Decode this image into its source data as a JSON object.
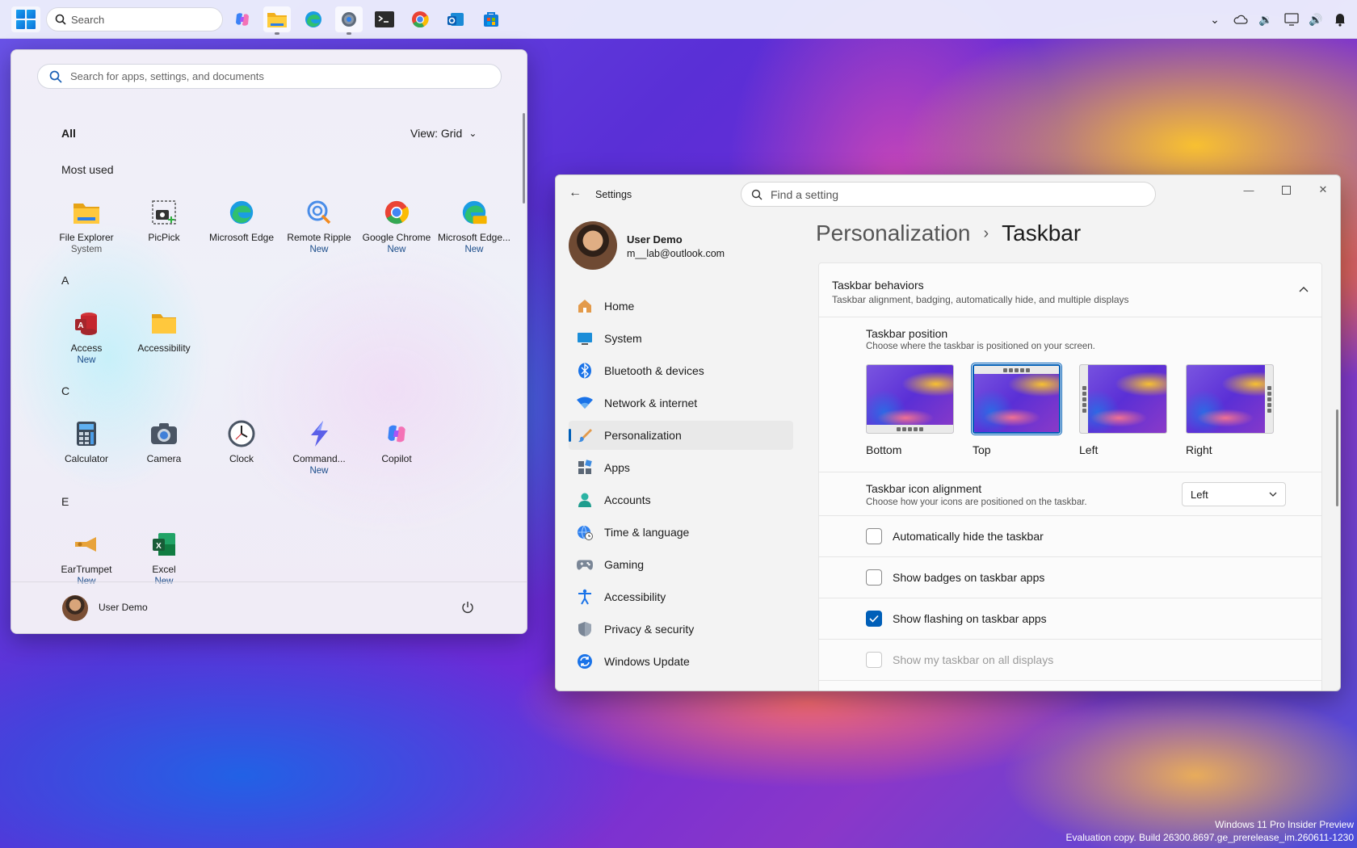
{
  "taskbar": {
    "search_label": "Search",
    "apps": [
      {
        "name": "copilot-icon"
      },
      {
        "name": "file-explorer-icon"
      },
      {
        "name": "edge-icon"
      },
      {
        "name": "settings-icon"
      },
      {
        "name": "terminal-icon"
      },
      {
        "name": "chrome-icon"
      },
      {
        "name": "outlook-icon"
      },
      {
        "name": "store-icon"
      }
    ],
    "tray": [
      "chevron-up-icon",
      "onedrive-cloud-icon",
      "volume-icon",
      "display-icon",
      "speaker-icon",
      "notification-bell-icon"
    ]
  },
  "start_menu": {
    "search_placeholder": "Search for apps, settings, and documents",
    "all_label": "All",
    "view_label": "View: Grid",
    "most_used_label": "Most used",
    "most_used": [
      {
        "label": "File Explorer",
        "sub": "System"
      },
      {
        "label": "PicPick",
        "sub": ""
      },
      {
        "label": "Microsoft Edge",
        "sub": ""
      },
      {
        "label": "Remote Ripple",
        "sub": "New"
      },
      {
        "label": "Google Chrome",
        "sub": "New"
      },
      {
        "label": "Microsoft Edge...",
        "sub": "New"
      }
    ],
    "section_a": "A",
    "apps_a": [
      {
        "label": "Access",
        "sub": "New"
      },
      {
        "label": "Accessibility",
        "sub": ""
      }
    ],
    "section_c": "C",
    "apps_c": [
      {
        "label": "Calculator",
        "sub": ""
      },
      {
        "label": "Camera",
        "sub": ""
      },
      {
        "label": "Clock",
        "sub": ""
      },
      {
        "label": "Command...",
        "sub": "New"
      },
      {
        "label": "Copilot",
        "sub": ""
      }
    ],
    "section_e": "E",
    "apps_e": [
      {
        "label": "EarTrumpet",
        "sub": "New"
      },
      {
        "label": "Excel",
        "sub": "New"
      }
    ],
    "footer_user": "User Demo"
  },
  "settings": {
    "window_title": "Settings",
    "search_placeholder": "Find a setting",
    "user_name": "User Demo",
    "user_email": "m__lab@outlook.com",
    "nav": [
      {
        "label": "Home",
        "icon": "home-icon"
      },
      {
        "label": "System",
        "icon": "system-icon"
      },
      {
        "label": "Bluetooth & devices",
        "icon": "bluetooth-icon"
      },
      {
        "label": "Network & internet",
        "icon": "wifi-icon"
      },
      {
        "label": "Personalization",
        "icon": "brush-icon"
      },
      {
        "label": "Apps",
        "icon": "apps-icon"
      },
      {
        "label": "Accounts",
        "icon": "accounts-icon"
      },
      {
        "label": "Time & language",
        "icon": "globe-clock-icon"
      },
      {
        "label": "Gaming",
        "icon": "gamepad-icon"
      },
      {
        "label": "Accessibility",
        "icon": "accessibility-icon"
      },
      {
        "label": "Privacy & security",
        "icon": "shield-icon"
      },
      {
        "label": "Windows Update",
        "icon": "update-icon"
      }
    ],
    "selected_nav": "Personalization",
    "breadcrumb_parent": "Personalization",
    "breadcrumb_separator": "›",
    "breadcrumb_current": "Taskbar",
    "behaviors": {
      "title": "Taskbar behaviors",
      "subtitle": "Taskbar alignment, badging, automatically hide, and multiple displays"
    },
    "position": {
      "title": "Taskbar position",
      "subtitle": "Choose where the taskbar is positioned on your screen.",
      "options": [
        "Bottom",
        "Top",
        "Left",
        "Right"
      ],
      "selected": "Top"
    },
    "alignment": {
      "title": "Taskbar icon alignment",
      "subtitle": "Choose how your icons are positioned on the taskbar.",
      "value": "Left"
    },
    "checkboxes": [
      {
        "label": "Automatically hide the taskbar",
        "checked": false,
        "disabled": false
      },
      {
        "label": "Show badges on taskbar apps",
        "checked": false,
        "disabled": false
      },
      {
        "label": "Show flashing on taskbar apps",
        "checked": true,
        "disabled": false
      },
      {
        "label": "Show my taskbar on all displays",
        "checked": false,
        "disabled": true
      }
    ]
  },
  "watermark": {
    "line1": "Windows 11 Pro Insider Preview",
    "line2": "Evaluation copy. Build 26300.8697.ge_prerelease_im.260611-1230"
  },
  "colors": {
    "accent": "#005fb8",
    "new_badge": "#1a4c8a"
  }
}
